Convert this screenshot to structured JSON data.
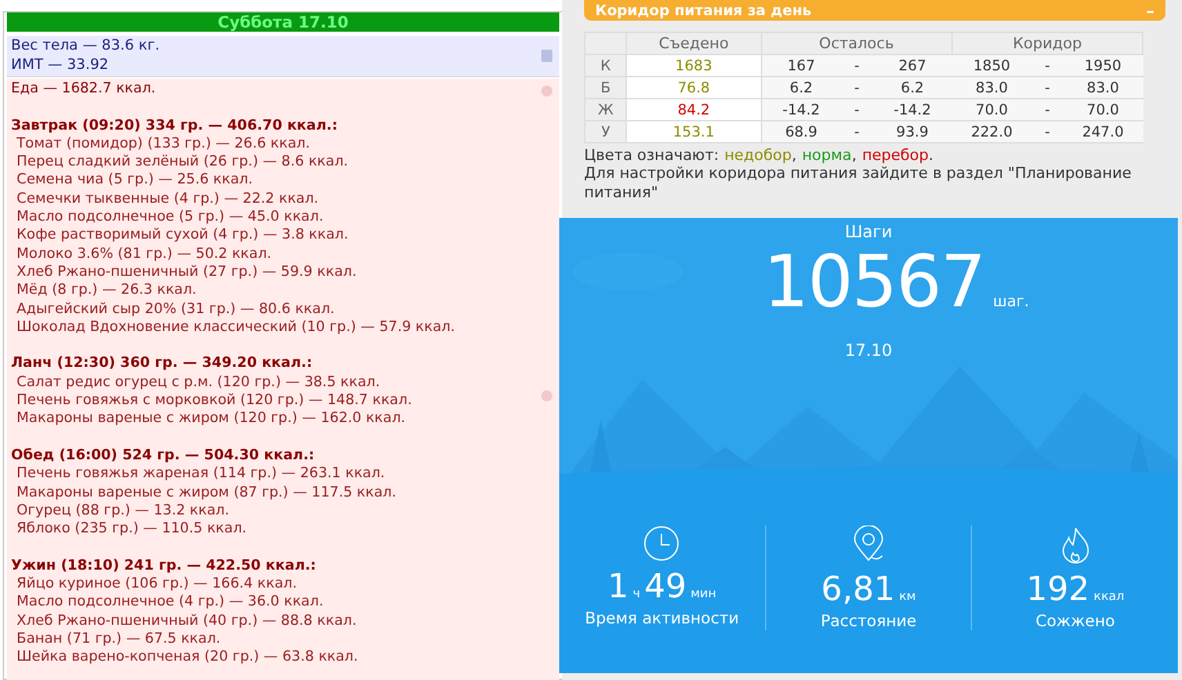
{
  "day": {
    "title": "Суббота 17.10"
  },
  "body": {
    "lines": [
      "Вес тела — 83.6 кг.",
      "ИМТ — 33.92"
    ]
  },
  "food": {
    "total": "Еда — 1682.7 ккал.",
    "meals": [
      {
        "title": "Завтрак (09:20) 334 гр. — 406.70 ккал.:",
        "items": [
          "Томат (помидор) (133 гр.) — 26.6 ккал.",
          "Перец сладкий зелёный (26 гр.) — 8.6 ккал.",
          "Семена чиа (5 гр.) — 25.6 ккал.",
          "Семечки тыквенные (4 гр.) — 22.2 ккал.",
          "Масло подсолнечное (5 гр.) — 45.0 ккал.",
          "Кофе растворимый сухой (4 гр.) — 3.8 ккал.",
          "Молоко 3.6% (81 гр.) — 50.2 ккал.",
          "Хлеб Ржано-пшеничный (27 гр.) — 59.9 ккал.",
          "Мёд (8 гр.) — 26.3 ккал.",
          "Адыгейский сыр 20% (31 гр.) — 80.6 ккал.",
          "Шоколад Вдохновение классический (10 гр.) — 57.9 ккал."
        ]
      },
      {
        "title": "Ланч (12:30) 360 гр. — 349.20 ккал.:",
        "items": [
          "Салат редис огурец с р.м. (120 гр.) — 38.5 ккал.",
          "Печень говяжья с морковкой (120 гр.) — 148.7 ккал.",
          "Макароны вареные с жиром (120 гр.) — 162.0 ккал."
        ]
      },
      {
        "title": "Обед (16:00) 524 гр. — 504.30 ккал.:",
        "items": [
          "Печень говяжья жареная (114 гр.) — 263.1 ккал.",
          "Макароны вареные с жиром (87 гр.) — 117.5 ккал.",
          "Огурец (88 гр.) — 13.2 ккал.",
          "Яблоко (235 гр.) — 110.5 ккал."
        ]
      },
      {
        "title": "Ужин (18:10) 241 гр. — 422.50 ккал.:",
        "items": [
          "Яйцо куриное (106 гр.) — 166.4 ккал.",
          "Масло подсолнечное (4 гр.) — 36.0 ккал.",
          "Хлеб Ржано-пшеничный (40 гр.) — 88.8 ккал.",
          "Банан (71 гр.) — 67.5 ккал.",
          "Шейка варено-копченая (20 гр.) — 63.8 ккал."
        ]
      }
    ]
  },
  "corridor": {
    "title": "Коридор питания за день",
    "collapse": "–",
    "columns": [
      "Съедено",
      "Осталось",
      "Коридор"
    ],
    "rows": [
      {
        "label": "К",
        "eaten": "1683",
        "color": "#8c8c00",
        "left_from": "167",
        "left_to": "267",
        "range_from": "1850",
        "range_to": "1950"
      },
      {
        "label": "Б",
        "eaten": "76.8",
        "color": "#8c8c00",
        "left_from": "6.2",
        "left_to": "6.2",
        "range_from": "83.0",
        "range_to": "83.0"
      },
      {
        "label": "Ж",
        "eaten": "84.2",
        "color": "#d40000",
        "left_from": "-14.2",
        "left_to": "-14.2",
        "range_from": "70.0",
        "range_to": "70.0"
      },
      {
        "label": "У",
        "eaten": "153.1",
        "color": "#8c8c00",
        "left_from": "68.9",
        "left_to": "93.9",
        "range_from": "222.0",
        "range_to": "247.0"
      }
    ],
    "dash": "-",
    "legend": {
      "label": "Цвета означают:",
      "parts": [
        {
          "text": "недобор",
          "color": "#8c8c00",
          "after": ","
        },
        {
          "text": "норма",
          "color": "#1a9a1a",
          "after": ","
        },
        {
          "text": "перебор",
          "color": "#d40000",
          "after": "."
        }
      ]
    },
    "note": "Для настройки коридора питания зайдите в раздел \"Планирование питания\""
  },
  "steps": {
    "title": "Шаги",
    "count": "10567",
    "unit": "шаг.",
    "date": "17.10",
    "stats": [
      {
        "kind": "time",
        "parts": [
          {
            "value": "1",
            "unit": "ч"
          },
          {
            "value": "49",
            "unit": "мин"
          }
        ],
        "label": "Время активности"
      },
      {
        "kind": "distance",
        "parts": [
          {
            "value": "6,81",
            "unit": "км"
          }
        ],
        "label": "Расстояние"
      },
      {
        "kind": "calories",
        "parts": [
          {
            "value": "192",
            "unit": "ккал"
          }
        ],
        "label": "Сожжено"
      }
    ]
  }
}
